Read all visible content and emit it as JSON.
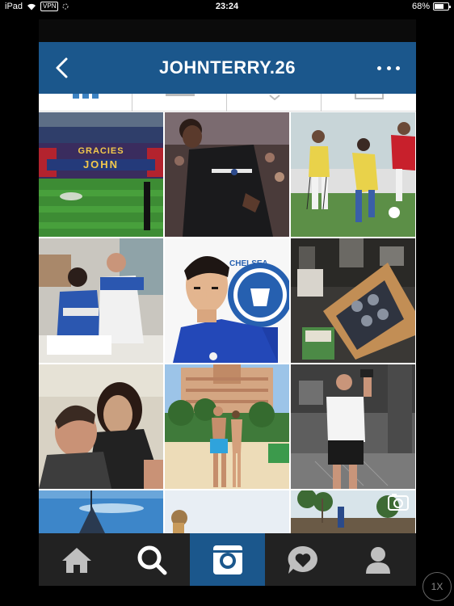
{
  "status_bar": {
    "device": "iPad",
    "vpn": "VPN",
    "time": "23:24",
    "battery_text": "68%",
    "battery_level": 0.68
  },
  "header": {
    "title": "JOHNTERRY.26"
  },
  "grid": {
    "photos": [
      {
        "subject": "stadium-banner",
        "banner_line1": "GRACIES",
        "banner_line2": "JOHN"
      },
      {
        "subject": "player-celebrating"
      },
      {
        "subject": "football-match"
      },
      {
        "subject": "two-players-in-office"
      },
      {
        "subject": "cartoon-player-illustration",
        "crest_text": "CHELSEA"
      },
      {
        "subject": "product-box"
      },
      {
        "subject": "couple-selfie"
      },
      {
        "subject": "resort-beach-couple"
      },
      {
        "subject": "gym-mirror-selfie"
      },
      {
        "subject": "sea-aerial"
      },
      {
        "subject": "sky-figure"
      },
      {
        "subject": "palm-trees-video"
      }
    ]
  },
  "tab_bar": {
    "items": [
      {
        "name": "home",
        "icon": "home-icon"
      },
      {
        "name": "search",
        "icon": "search-icon"
      },
      {
        "name": "camera",
        "icon": "camera-icon",
        "active": true
      },
      {
        "name": "activity",
        "icon": "heart-bubble-icon"
      },
      {
        "name": "profile",
        "icon": "profile-icon"
      }
    ]
  },
  "zoom_badge": "1X",
  "colors": {
    "header_blue": "#1b578c",
    "tab_bar": "#222222",
    "active_tab": "#1b578c"
  }
}
